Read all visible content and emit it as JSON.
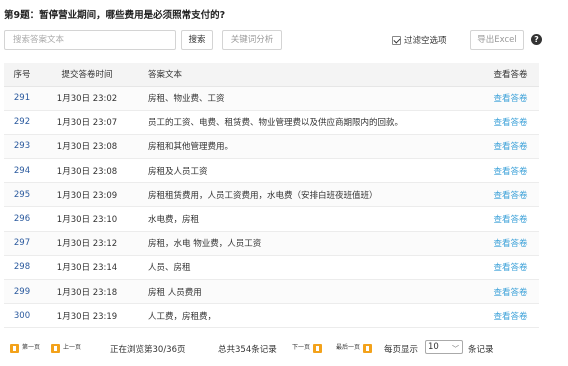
{
  "question": "第9题：暂停营业期间，哪些费用是必须照常支付的?",
  "toolbar": {
    "search_placeholder": "搜索答案文本",
    "search_button": "搜索",
    "keyword_button": "关键词分析",
    "filter_label": "过滤空选项",
    "filter_checked": true,
    "export_button": "导出Excel",
    "help_icon": "?"
  },
  "table": {
    "headers": [
      "序号",
      "提交答卷时间",
      "答案文本",
      "查看答卷"
    ],
    "rows": [
      {
        "no": "291",
        "time": "1月30日 23:02",
        "text": "房租、物业费、工资",
        "view": "查看答卷"
      },
      {
        "no": "292",
        "time": "1月30日 23:07",
        "text": "员工的工资、电费、租赁费、物业管理费以及供应商期限内的回款。",
        "view": "查看答卷"
      },
      {
        "no": "293",
        "time": "1月30日 23:08",
        "text": "房租和其他管理费用。",
        "view": "查看答卷"
      },
      {
        "no": "294",
        "time": "1月30日 23:08",
        "text": "房租及人员工资",
        "view": "查看答卷"
      },
      {
        "no": "295",
        "time": "1月30日 23:09",
        "text": "房租租赁费用，人员工资费用，水电费（安排白班夜班值班）",
        "view": "查看答卷"
      },
      {
        "no": "296",
        "time": "1月30日 23:10",
        "text": "水电费，房租",
        "view": "查看答卷"
      },
      {
        "no": "297",
        "time": "1月30日 23:12",
        "text": "房租，水电 物业费，人员工资",
        "view": "查看答卷"
      },
      {
        "no": "298",
        "time": "1月30日 23:14",
        "text": "人员、房租",
        "view": "查看答卷"
      },
      {
        "no": "299",
        "time": "1月30日 23:18",
        "text": "房租 人员费用",
        "view": "查看答卷"
      },
      {
        "no": "300",
        "time": "1月30日 23:19",
        "text": "人工费，房租费，",
        "view": "查看答卷"
      }
    ]
  },
  "pager": {
    "first": "第一页",
    "prev": "上一页",
    "status": "正在浏览第30/36页",
    "total": "总共354条记录",
    "next": "下一页",
    "last": "最后一页",
    "per_page_label": "每页显示",
    "per_page_value": "10",
    "per_page_suffix": "条记录"
  },
  "colors": {
    "accent_link": "#3aa0d8",
    "row_number": "#2b5a9e",
    "pager_icon": "#f3a21b"
  }
}
